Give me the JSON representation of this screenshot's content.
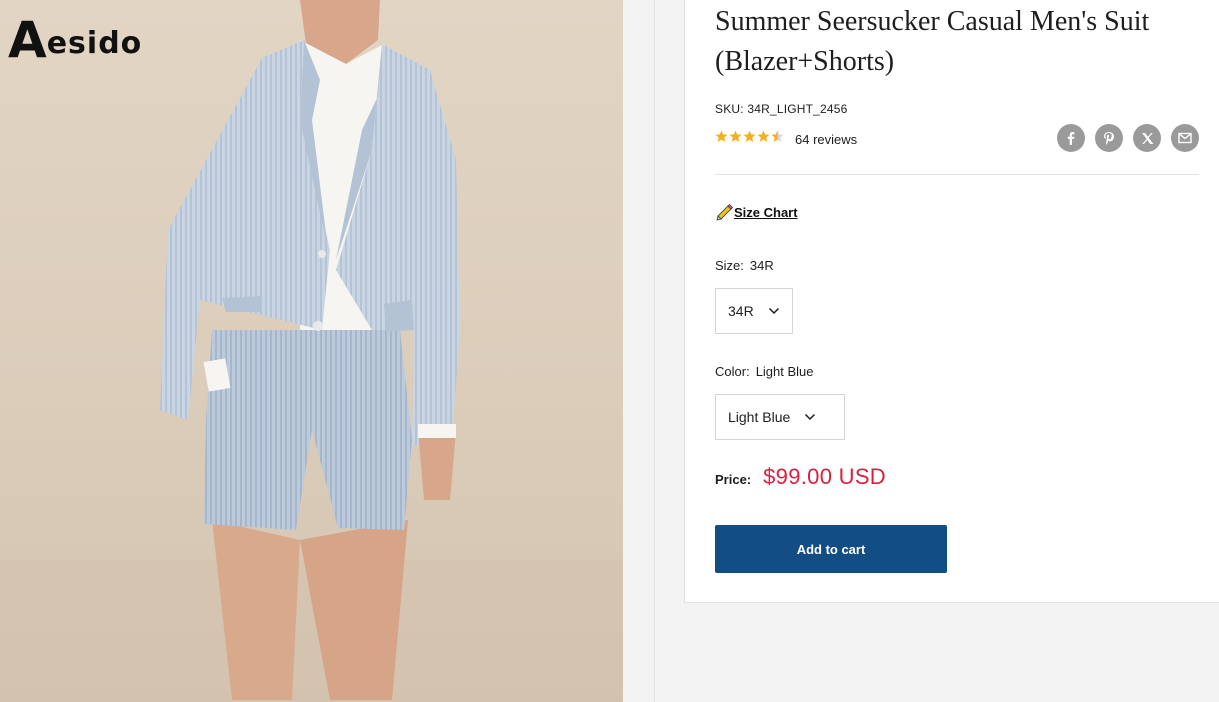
{
  "brand": {
    "logo_initial": "A",
    "logo_rest": "esido"
  },
  "product": {
    "title": "Summer Seersucker Casual Men's Suit (Blazer+Shorts)",
    "sku_label": "SKU:",
    "sku_value": "34R_LIGHT_2456",
    "rating": 4.5,
    "rating_max": 5,
    "review_count_text": "64 reviews",
    "star_color": "#f2b01e"
  },
  "share": {
    "icons": [
      "facebook-icon",
      "pinterest-icon",
      "x-twitter-icon",
      "email-icon"
    ]
  },
  "size_chart": {
    "label": "Size Chart",
    "icon": "ruler-pencil-icon"
  },
  "size": {
    "label": "Size:",
    "selected": "34R",
    "select_value": "34R"
  },
  "color": {
    "label": "Color:",
    "selected": "Light Blue",
    "select_value": "Light Blue"
  },
  "price": {
    "label": "Price:",
    "value": "$99.00 USD",
    "color": "#d7223e"
  },
  "cart": {
    "button_label": "Add to cart",
    "button_color": "#124d84"
  }
}
